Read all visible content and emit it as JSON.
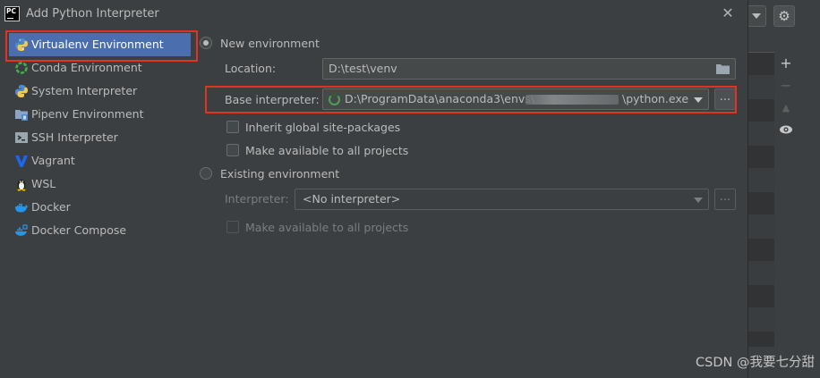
{
  "window": {
    "title": "Add Python Interpreter",
    "app_icon_text": "PC"
  },
  "sidebar": {
    "items": [
      {
        "label": "Virtualenv Environment",
        "icon": "python-icon",
        "selected": true
      },
      {
        "label": "Conda Environment",
        "icon": "conda-icon",
        "selected": false
      },
      {
        "label": "System Interpreter",
        "icon": "python-icon",
        "selected": false
      },
      {
        "label": "Pipenv Environment",
        "icon": "pipenv-folder-icon",
        "selected": false
      },
      {
        "label": "SSH Interpreter",
        "icon": "ssh-terminal-icon",
        "selected": false
      },
      {
        "label": "Vagrant",
        "icon": "vagrant-icon",
        "selected": false
      },
      {
        "label": "WSL",
        "icon": "linux-penguin-icon",
        "selected": false
      },
      {
        "label": "Docker",
        "icon": "docker-whale-icon",
        "selected": false
      },
      {
        "label": "Docker Compose",
        "icon": "docker-compose-icon",
        "selected": false
      }
    ]
  },
  "main": {
    "new_env": {
      "label": "New environment",
      "selected": true,
      "location_label": "Location:",
      "location_value": "D:\\test\\venv",
      "base_label": "Base interpreter:",
      "base_value_prefix": "D:\\ProgramData\\anaconda3\\envs\\",
      "base_value_suffix": "\\python.exe",
      "browse_label": "...",
      "inherit_label": "Inherit global site-packages",
      "inherit_checked": false,
      "available_label": "Make available to all projects",
      "available_checked": false
    },
    "existing_env": {
      "label": "Existing environment",
      "selected": false,
      "interpreter_label": "Interpreter:",
      "interpreter_value": "<No interpreter>",
      "browse_label": "...",
      "available_label": "Make available to all projects",
      "available_checked": false
    }
  },
  "background": {
    "tool_icons": [
      "plus-icon",
      "minus-icon",
      "up-arrow-icon",
      "eye-icon"
    ],
    "settings_icon": "gear-icon"
  },
  "watermark": "CSDN @我要七分甜",
  "colors": {
    "selection": "#4b6eaf",
    "highlight_box": "#e03322",
    "dialog_bg": "#3c3f41"
  }
}
